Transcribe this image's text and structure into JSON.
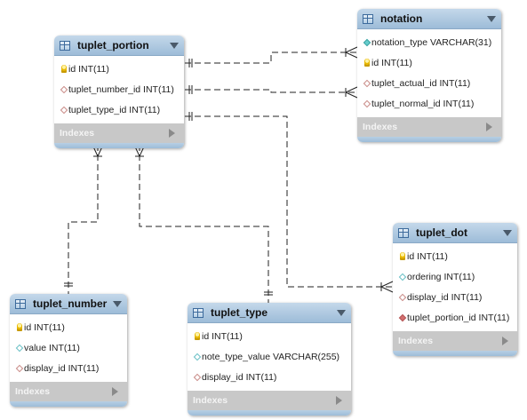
{
  "tables": {
    "tuplet_portion": {
      "title": "tuplet_portion",
      "indexes_label": "Indexes",
      "columns": [
        {
          "text": "id INT(11)",
          "icon": "primary-key-icon"
        },
        {
          "text": "tuplet_number_id INT(11)",
          "icon": "foreign-key-icon"
        },
        {
          "text": "tuplet_type_id INT(11)",
          "icon": "foreign-key-icon"
        }
      ]
    },
    "notation": {
      "title": "notation",
      "indexes_label": "Indexes",
      "columns": [
        {
          "text": "notation_type VARCHAR(31)",
          "icon": "not-null-column-icon"
        },
        {
          "text": "id INT(11)",
          "icon": "primary-key-icon"
        },
        {
          "text": "tuplet_actual_id INT(11)",
          "icon": "foreign-key-icon"
        },
        {
          "text": "tuplet_normal_id INT(11)",
          "icon": "foreign-key-icon"
        }
      ]
    },
    "tuplet_dot": {
      "title": "tuplet_dot",
      "indexes_label": "Indexes",
      "columns": [
        {
          "text": "id INT(11)",
          "icon": "primary-key-icon"
        },
        {
          "text": "ordering INT(11)",
          "icon": "column-icon"
        },
        {
          "text": "display_id INT(11)",
          "icon": "foreign-key-icon"
        },
        {
          "text": "tuplet_portion_id INT(11)",
          "icon": "foreign-key-not-null-icon"
        }
      ]
    },
    "tuplet_number": {
      "title": "tuplet_number",
      "indexes_label": "Indexes",
      "columns": [
        {
          "text": "id INT(11)",
          "icon": "primary-key-icon"
        },
        {
          "text": "value INT(11)",
          "icon": "column-icon"
        },
        {
          "text": "display_id INT(11)",
          "icon": "foreign-key-icon"
        }
      ]
    },
    "tuplet_type": {
      "title": "tuplet_type",
      "indexes_label": "Indexes",
      "columns": [
        {
          "text": "id INT(11)",
          "icon": "primary-key-icon"
        },
        {
          "text": "note_type_value VARCHAR(255)",
          "icon": "column-icon"
        },
        {
          "text": "display_id INT(11)",
          "icon": "foreign-key-icon"
        }
      ]
    }
  },
  "colors": {
    "header": "#9dbcd8",
    "indexes_bar": "#c8c8c8",
    "connector": "#222222"
  },
  "relationships": [
    {
      "from": "notation",
      "to": "tuplet_portion",
      "type": "one-to-many"
    },
    {
      "from": "notation",
      "to": "tuplet_portion",
      "type": "one-to-many"
    },
    {
      "from": "tuplet_dot",
      "to": "tuplet_portion",
      "type": "one-to-many"
    },
    {
      "from": "tuplet_portion",
      "to": "tuplet_number",
      "type": "many-to-one"
    },
    {
      "from": "tuplet_portion",
      "to": "tuplet_type",
      "type": "many-to-one"
    }
  ]
}
